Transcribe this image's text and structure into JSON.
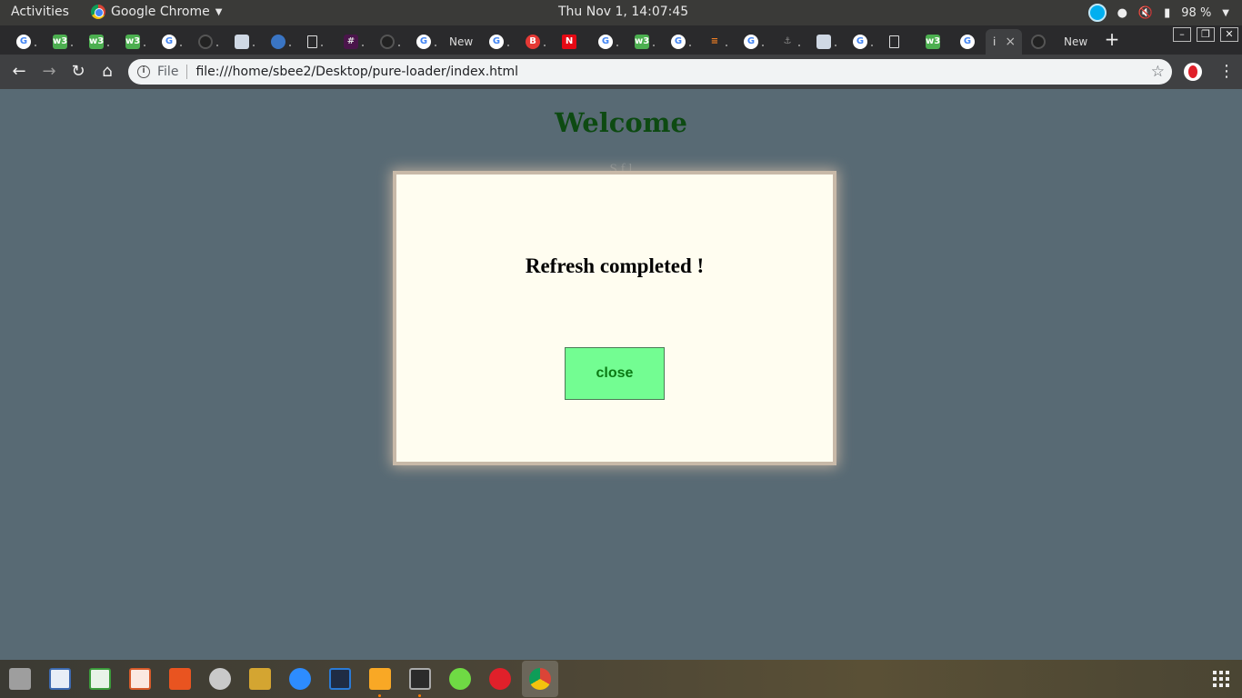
{
  "topbar": {
    "activities": "Activities",
    "app_name": "Google Chrome",
    "clock": "Thu Nov  1, 14:07:45",
    "battery": "98 %"
  },
  "tabs": {
    "new_tab_labels": [
      "New",
      "New"
    ],
    "active_tab_label": "i",
    "close_glyph": "×"
  },
  "toolbar": {
    "scheme_label": "File",
    "url": "file:///home/sbee2/Desktop/pure-loader/index.html"
  },
  "page": {
    "heading": "Welcome",
    "faded_text": "S        f  l"
  },
  "modal": {
    "title": "Refresh completed !",
    "close_label": "close"
  },
  "colors": {
    "page_bg": "#586a74",
    "heading": "#0d4a12",
    "modal_bg": "#fffdf0",
    "button_bg": "#73fd92",
    "button_text": "#0b7a14"
  }
}
